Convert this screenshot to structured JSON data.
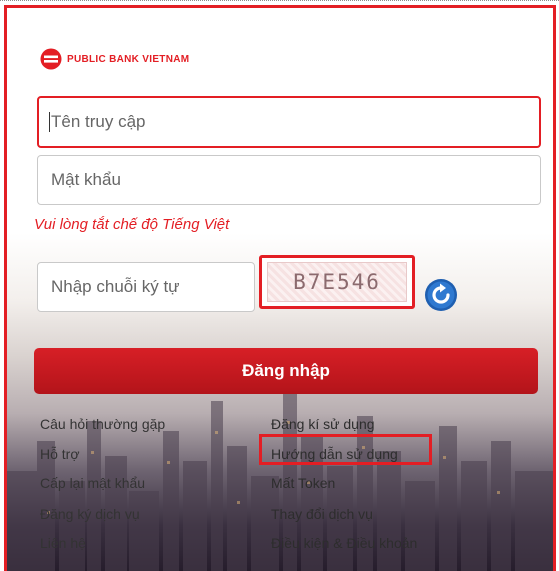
{
  "brand": {
    "name": "PUBLIC BANK VIETNAM",
    "accent": "#e31e24"
  },
  "form": {
    "username_placeholder": "Tên truy cập",
    "password_placeholder": "Mật khẩu",
    "hint": "Vui lòng tắt chế độ Tiếng Việt",
    "captcha_placeholder": "Nhập chuỗi ký tự",
    "captcha_text": "B7E546",
    "refresh_icon": "refresh-icon",
    "login_label": "Đăng nhập"
  },
  "links": {
    "left": [
      "Câu hỏi thường gặp",
      "Hỗ trợ",
      "Cấp lại mật khẩu",
      "Đăng ký dịch vụ",
      "Liên hệ"
    ],
    "right": [
      "Đăng kí sử dụng",
      "Hướng dẫn sử dụng",
      "Mất Token",
      "Thay đổi dịch vụ",
      "Điều kiện & Điều khoản"
    ]
  }
}
